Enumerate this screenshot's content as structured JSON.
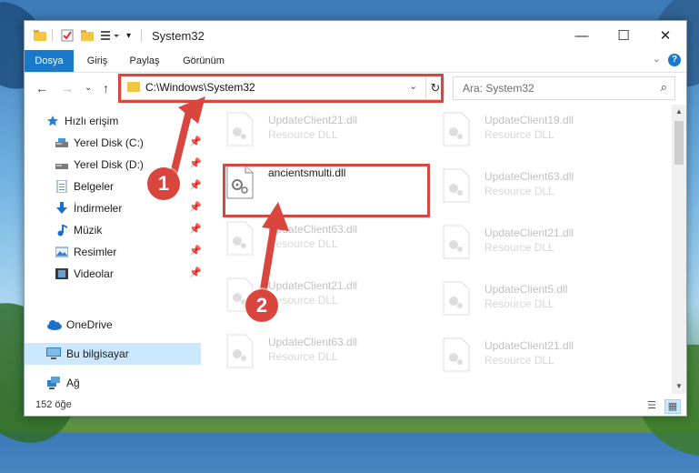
{
  "window": {
    "title": "System32"
  },
  "window_controls": {
    "minimize": "—",
    "maximize": "☐",
    "close": "✕"
  },
  "ribbon": {
    "tabs": [
      {
        "label": "Dosya",
        "active": true
      },
      {
        "label": "Giriş"
      },
      {
        "label": "Paylaş"
      },
      {
        "label": "Görünüm"
      }
    ],
    "help": "?"
  },
  "navigation": {
    "address": "C:\\Windows\\System32",
    "search_placeholder": "Ara: System32"
  },
  "sidebar": {
    "items": [
      {
        "label": "Hızlı erişim",
        "icon": "star-icon",
        "pinned": false
      },
      {
        "label": "Yerel Disk (C:)",
        "icon": "drive-icon",
        "pinned": true
      },
      {
        "label": "Yerel Disk (D:)",
        "icon": "drive-icon",
        "pinned": true
      },
      {
        "label": "Belgeler",
        "icon": "documents-icon",
        "pinned": true
      },
      {
        "label": "İndirmeler",
        "icon": "download-icon",
        "pinned": true
      },
      {
        "label": "Müzik",
        "icon": "music-icon",
        "pinned": true
      },
      {
        "label": "Resimler",
        "icon": "pictures-icon",
        "pinned": true
      },
      {
        "label": "Videolar",
        "icon": "video-icon",
        "pinned": true
      },
      {
        "label": "OneDrive",
        "icon": "cloud-icon"
      },
      {
        "label": "Bu bilgisayar",
        "icon": "computer-icon",
        "selected": true
      },
      {
        "label": "Ağ",
        "icon": "network-icon"
      }
    ]
  },
  "files": {
    "left": [
      {
        "name": "UpdateClient21.dll",
        "desc": "Resource DLL"
      },
      {
        "name": "ancientsmulti.dll",
        "desc": ""
      },
      {
        "name": "UpdateClient63.dll",
        "desc": "Resource DLL"
      },
      {
        "name": "UpdateClient21.dll",
        "desc": "Resource DLL"
      },
      {
        "name": "UpdateClient63.dll",
        "desc": "Resource DLL"
      }
    ],
    "right": [
      {
        "name": "UpdateClient19.dll",
        "desc": "Resource DLL"
      },
      {
        "name": "UpdateClient63.dll",
        "desc": "Resource DLL"
      },
      {
        "name": "UpdateClient21.dll",
        "desc": "Resource DLL"
      },
      {
        "name": "UpdateClient5.dll",
        "desc": "Resource DLL"
      },
      {
        "name": "UpdateClient21.dll",
        "desc": "Resource DLL"
      }
    ]
  },
  "status": {
    "count": "152 öğe"
  },
  "annotations": {
    "step1": "1",
    "step2": "2"
  },
  "colors": {
    "accent": "#1979ca",
    "highlight": "#d8463e",
    "selection": "#cce8ff"
  }
}
